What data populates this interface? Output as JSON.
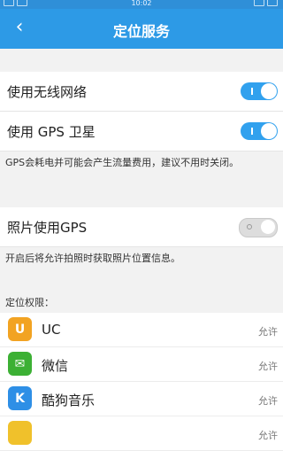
{
  "status_bar": {
    "clock": "10:02"
  },
  "header": {
    "title": "定位服务"
  },
  "settings": {
    "wifi": {
      "label": "使用无线网络",
      "enabled": true
    },
    "gps": {
      "label": "使用 GPS 卫星",
      "enabled": true
    },
    "gps_note": "GPS会耗电并可能会产生流量费用，建议不用时关闭。",
    "photo_gps": {
      "label": "照片使用GPS",
      "enabled": false
    },
    "photo_note": "开启后将允许拍照时获取照片位置信息。"
  },
  "permissions": {
    "header": "定位权限：",
    "apps": [
      {
        "name": "UC",
        "status": "允许",
        "icon": "uc-browser-icon",
        "color": "#f2a322"
      },
      {
        "name": "微信",
        "status": "允许",
        "icon": "wechat-icon",
        "color": "#3cb034"
      },
      {
        "name": "酷狗音乐",
        "status": "允许",
        "icon": "kugou-icon",
        "color": "#2e8fe6"
      },
      {
        "name": "",
        "status": "允许",
        "icon": "app-icon",
        "color": "#f0c12b"
      }
    ]
  },
  "colors": {
    "accent": "#2d9ae6",
    "toggle_on": "#31a1ee"
  }
}
